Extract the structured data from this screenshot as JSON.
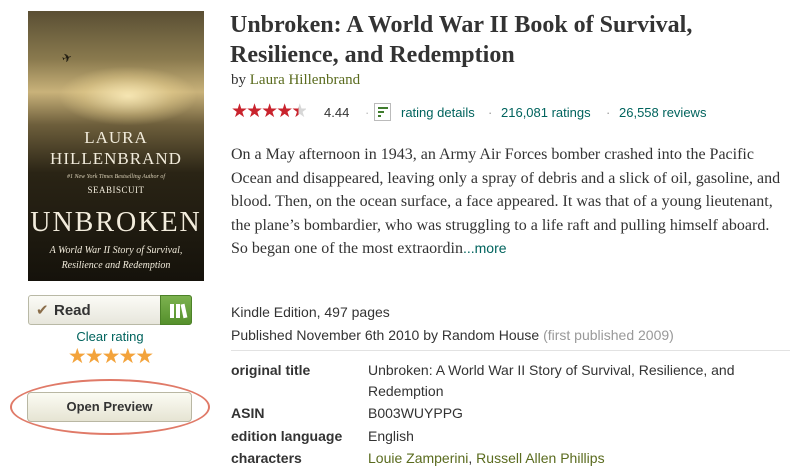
{
  "cover": {
    "author_line1": "LAURA",
    "author_line2": "HILLENBRAND",
    "blurb": "#1 New York Times Bestselling Author of",
    "previous_book": "SEABISCUIT",
    "title": "UNBROKEN",
    "subtitle_line1": "A World War II Story of Survival,",
    "subtitle_line2": "Resilience and Redemption"
  },
  "shelf": {
    "status_label": "Read",
    "clear_rating_label": "Clear rating",
    "user_stars": "★★★★★"
  },
  "preview": {
    "button_label": "Open Preview"
  },
  "book": {
    "title": "Unbroken: A World War II Book of Survival, Resilience, and Redemption",
    "by_label": "by",
    "author": "Laura Hillenbrand"
  },
  "rating": {
    "average": "4.44",
    "average_fraction": 0.888,
    "details_label": "rating details",
    "ratings_count": "216,081 ratings",
    "reviews_count": "26,558 reviews",
    "separator": "·",
    "star_color": "#c9232d"
  },
  "description": {
    "text": "On a May afternoon in 1943, an Army Air Forces bomber crashed into the Pacific Ocean and disappeared, leaving only a spray of debris and a slick of oil, gasoline, and blood. Then, on the ocean surface, a face appeared. It was that of a young lieutenant, the plane’s bombardier, who was struggling to a life raft and pulling himself aboard. So began one of the most extraordin",
    "more_label": "...more"
  },
  "details": {
    "edition": "Kindle Edition, 497 pages",
    "published": "Published November 6th 2010 by Random House",
    "first_published": "(first published 2009)",
    "rows": [
      {
        "key": "original title",
        "value": "Unbroken: A World War II Story of Survival, Resilience, and Redemption"
      },
      {
        "key": "ASIN",
        "value": "B003WUYPPG"
      },
      {
        "key": "edition language",
        "value": "English"
      },
      {
        "key": "characters",
        "links": [
          "Louie Zamperini",
          "Russell Allen Phillips"
        ],
        "link_separator": ", "
      }
    ]
  },
  "colors": {
    "link_green": "#00635d",
    "author_olive": "#5a6b1e",
    "user_star_orange": "#f3a33b",
    "highlight_ring": "#e07a68"
  }
}
